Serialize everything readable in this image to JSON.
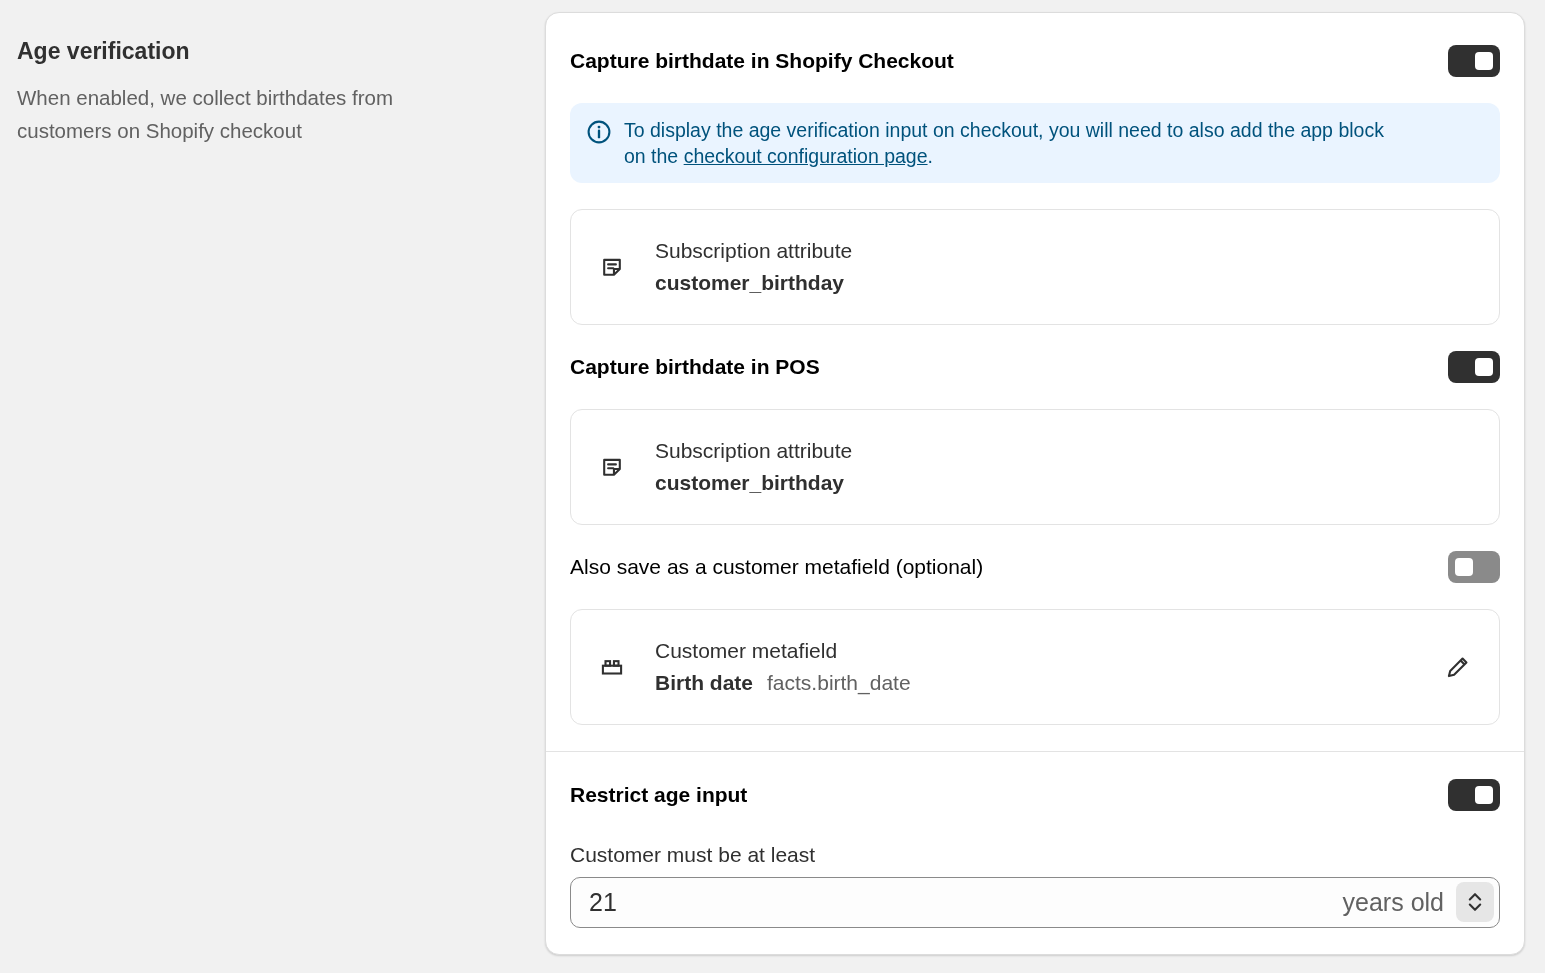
{
  "section": {
    "title": "Age verification",
    "description": "When enabled, we collect birthdates from customers on Shopify checkout"
  },
  "groups": [
    {
      "items": [
        {
          "kind": "toggle",
          "label": "Capture birthdate in Shopify Checkout",
          "strong": true,
          "on": true
        },
        {
          "kind": "banner",
          "text": "To display the age verification input on checkout, you will need to also add the app block on the ",
          "link": "checkout configuration page",
          "suffix": "."
        },
        {
          "kind": "attribute",
          "title": "Subscription attribute",
          "value": "customer_birthday"
        },
        {
          "kind": "toggle",
          "label": "Capture birthdate in POS",
          "strong": true,
          "on": true
        },
        {
          "kind": "attribute",
          "title": "Subscription attribute",
          "value": "customer_birthday"
        },
        {
          "kind": "toggle",
          "label": "Also save as a customer metafield (optional)",
          "strong": false,
          "on": false
        },
        {
          "kind": "metafield",
          "title": "Customer metafield",
          "name": "Birth date",
          "key": "facts.birth_date"
        }
      ]
    },
    {
      "items": [
        {
          "kind": "toggle",
          "label": "Restrict age input",
          "strong": true,
          "on": true
        },
        {
          "kind": "number",
          "label": "Customer must be at least",
          "value": "21",
          "suffix": "years old"
        }
      ]
    }
  ]
}
